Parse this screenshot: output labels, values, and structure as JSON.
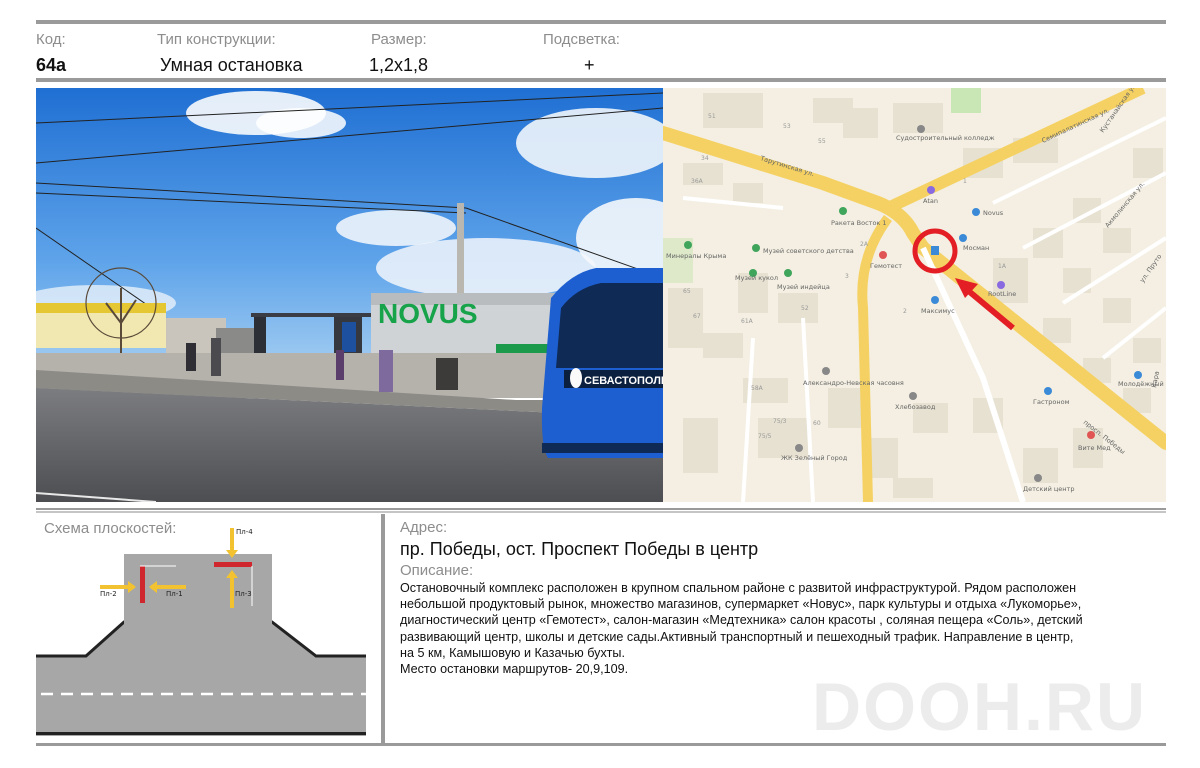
{
  "header": {
    "code_label": "Код:",
    "code_value": "64а",
    "type_label": "Тип конструкции:",
    "type_value": "Умная остановка",
    "size_label": "Размер:",
    "size_value": "1,2x1,8",
    "light_label": "Подсветка:",
    "light_value": "+"
  },
  "photo": {
    "store_sign": "NOVUS",
    "bus_sign": "СЕВАСТОПОЛЬ"
  },
  "map": {
    "streets": [
      "Тарутинская ул.",
      "просп. Победы",
      "Семипалатинская ул.",
      "Кустанайская ул.",
      "Акмолинская ул.",
      "ул. Пруто",
      "Кара"
    ],
    "pois": [
      "Судостроительный колледж",
      "Ракета Восток",
      "Атан",
      "Novus",
      "Minerals Crimea",
      "Музей советского детства",
      "Музей кукол",
      "Музей индейца",
      "Гемотест",
      "RootLine",
      "Максимус",
      "Молодёжный",
      "Гастроном",
      "Александро-Невская часовня",
      "Хлебозавод",
      "ЖК Зелёный Город",
      "Вите Мед",
      "Детский сад",
      "Ворона"
    ],
    "poi_short": [
      "Минералы Крыма",
      "Музей советского детства",
      "Музей кукол",
      "Музей индейца",
      "Ракета Восток 1",
      "Гемотест",
      "Atan",
      "Novus",
      "Мосман",
      "RootLine",
      "Максимус",
      "Молодёжный",
      "Гастроном",
      "Александро-Невская часовня",
      "Хлебозавод",
      "ЖК Зелёный Город",
      "Вите Мед",
      "Детский центр",
      "Воронц"
    ],
    "house_numbers": [
      "51",
      "53",
      "55",
      "34",
      "36А",
      "2А",
      "1А",
      "65",
      "67",
      "61А",
      "52",
      "58А",
      "60",
      "75/3",
      "75/5",
      "2",
      "3",
      "1"
    ],
    "accent_color": "#e31e24"
  },
  "scheme": {
    "title": "Схема плоскостей:",
    "planes": [
      "Пл-1",
      "Пл-2",
      "Пл-3",
      "Пл-4"
    ],
    "plane_color": "#d0262d",
    "arrow_color": "#f2c230"
  },
  "address": {
    "label": "Адрес:",
    "text": "пр. Победы, ост. Проспект Победы в центр"
  },
  "description": {
    "label": "Описание:",
    "lines": [
      "Остановочный комплекс расположен в крупном спальном районе с развитой инфраструктурой. Рядом расположен",
      "небольшой продуктовый рынок, множество  магазинов,  супермаркет «Новус», парк культуры и отдыха «Лукоморье»,",
      "диагностический центр «Гемотест», салон-магазин «Медтехника» салон красоты , соляная пещера «Соль», детский",
      "развивающий центр, школы и детские сады.Активный  транспортный и пешеходный  трафик. Направление в центр,",
      "на 5 км, Камышовую и Казачью бухты.",
      "Место остановки маршрутов- 20,9,109."
    ]
  },
  "watermark": "DOOH.RU"
}
